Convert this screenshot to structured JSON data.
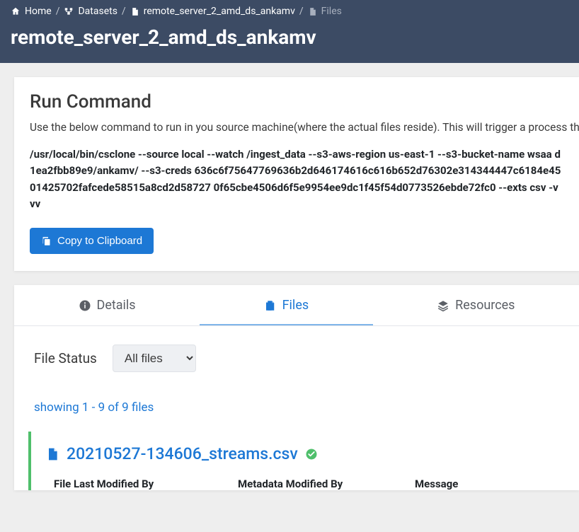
{
  "breadcrumb": {
    "home": "Home",
    "datasets": "Datasets",
    "datasetName": "remote_server_2_amd_ds_ankamv",
    "current": "Files"
  },
  "title": "remote_server_2_amd_ds_ankamv",
  "runCard": {
    "heading": "Run Command",
    "description": "Use the below command to run in you source machine(where the actual files reside). This will trigger a process th",
    "command": "/usr/local/bin/csclone --source local --watch /ingest_data --s3-aws-region us-east-1 --s3-bucket-name wsaa d1ea2fbb89e9/ankamv/ --s3-creds 636c6f75647769636b2d646174616c616b652d76302e314344447c6184e4501425702fafcede58515a8cd2d58727 0f65cbe4506d6f5e9954ee9dc1f45f54d0773526ebde72fc0 --exts csv -vvv",
    "copyBtn": "Copy to Clipboard"
  },
  "tabs": {
    "details": "Details",
    "files": "Files",
    "resources": "Resources"
  },
  "filter": {
    "label": "File Status",
    "selected": "All files"
  },
  "showing": "showing 1 - 9 of 9 files",
  "file": {
    "name": "20210527-134606_streams.csv",
    "status": "ok"
  },
  "columns": {
    "c1": "File Last Modified By",
    "c2": "Metadata Modified By",
    "c3": "Message"
  }
}
